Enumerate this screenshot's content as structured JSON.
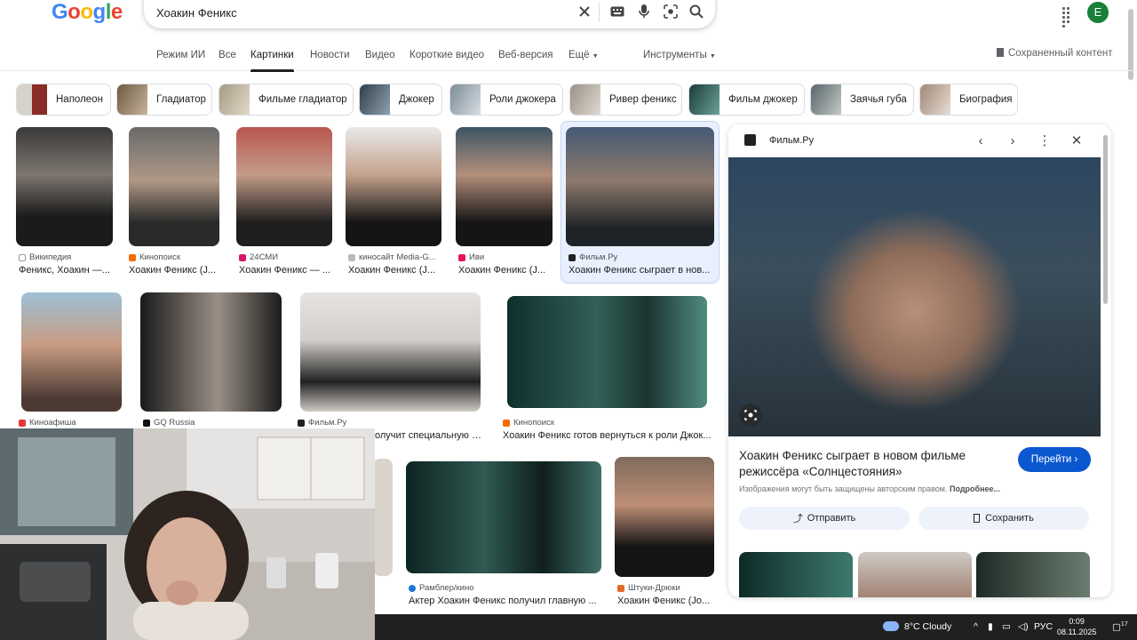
{
  "header": {
    "logo": "Google",
    "query": "Хоакин Феникс"
  },
  "avatar": "E",
  "tabs": [
    "Режим ИИ",
    "Все",
    "Картинки",
    "Новости",
    "Видео",
    "Короткие видео",
    "Веб-версия",
    "Ещё",
    "Инструменты"
  ],
  "saved": "Сохраненный контент",
  "chips": [
    "Наполеон",
    "Гладиатор",
    "Фильме гладиатор",
    "Джокер",
    "Роли джокера",
    "Ривер феникс",
    "Фильм джокер",
    "Заячья губа",
    "Биография"
  ],
  "row1": [
    {
      "source": "Википедия",
      "caption": "Феникс, Хоакин —..."
    },
    {
      "source": "Кинопоиск",
      "caption": "Хоакин Феникс (J..."
    },
    {
      "source": "24СМИ",
      "caption": "Хоакин Феникс — ..."
    },
    {
      "source": "киносайт Media-G...",
      "caption": "Хоакин Феникс (J..."
    },
    {
      "source": "Иви",
      "caption": "Хоакин Феникс (J..."
    },
    {
      "source": "Фильм.Ру",
      "caption": "Хоакин Феникс сыграет в нов..."
    }
  ],
  "row2": [
    {
      "source": "Киноафиша",
      "caption": ""
    },
    {
      "source": "GQ Russia",
      "caption": ""
    },
    {
      "source": "Фильм.Ру",
      "caption": "олучит специальную н..."
    },
    {
      "source": "Кинопоиск",
      "caption": "Хоакин Феникс готов вернуться к роли Джок..."
    }
  ],
  "row3": [
    {
      "source": "Рамблер/кино",
      "caption": "Актер Хоакин Феникс получил главную ..."
    },
    {
      "source": "Штуки-Дрюки",
      "caption": "Хоакин Феникс (Jo..."
    }
  ],
  "panel": {
    "site": "Фильм.Ру",
    "title": "Хоакин Феникс сыграет в новом фильме режиссёра «Солнцестояния»",
    "visit": "Перейти",
    "copyright": "Изображения могут быть защищены авторским правом.",
    "more": "Подробнее...",
    "share": "Отправить",
    "save": "Сохранить"
  },
  "taskbar": {
    "weather": "8°C  Cloudy",
    "lang": "РУС",
    "time": "0:09",
    "date": "08.11.2025",
    "notif": "17"
  }
}
